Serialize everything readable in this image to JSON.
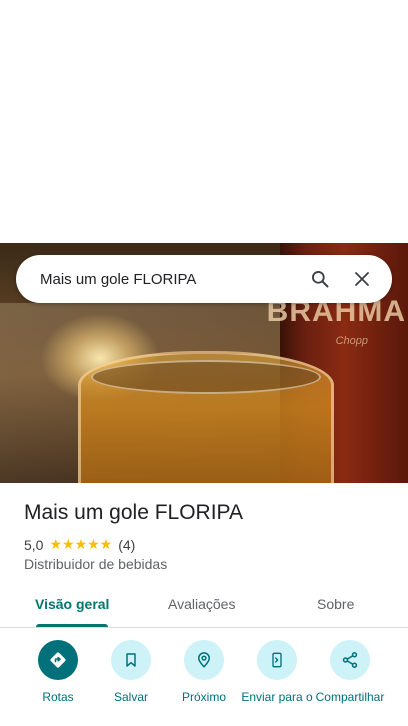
{
  "search": {
    "query": "Mais um gole FLORIPA"
  },
  "hero": {
    "can_brand": "BRAHMA",
    "can_sub": "Chopp"
  },
  "place": {
    "name": "Mais um gole FLORIPA",
    "rating": "5,0",
    "stars": "★★★★★",
    "reviews_count": "(4)",
    "category": "Distribuidor de bebidas"
  },
  "tabs": [
    {
      "label": "Visão geral",
      "active": true
    },
    {
      "label": "Avaliações",
      "active": false
    },
    {
      "label": "Sobre",
      "active": false
    }
  ],
  "actions": [
    {
      "label": "Rotas",
      "icon": "directions-icon"
    },
    {
      "label": "Salvar",
      "icon": "bookmark-icon"
    },
    {
      "label": "Próximo",
      "icon": "nearby-icon"
    },
    {
      "label": "Enviar para o",
      "icon": "send-to-phone-icon"
    },
    {
      "label": "Compartilhar",
      "icon": "share-icon"
    }
  ],
  "colors": {
    "accent": "#00786b",
    "star": "#fbbc04",
    "action_bg": "#cdf2f7",
    "primary_action": "#00707a"
  }
}
